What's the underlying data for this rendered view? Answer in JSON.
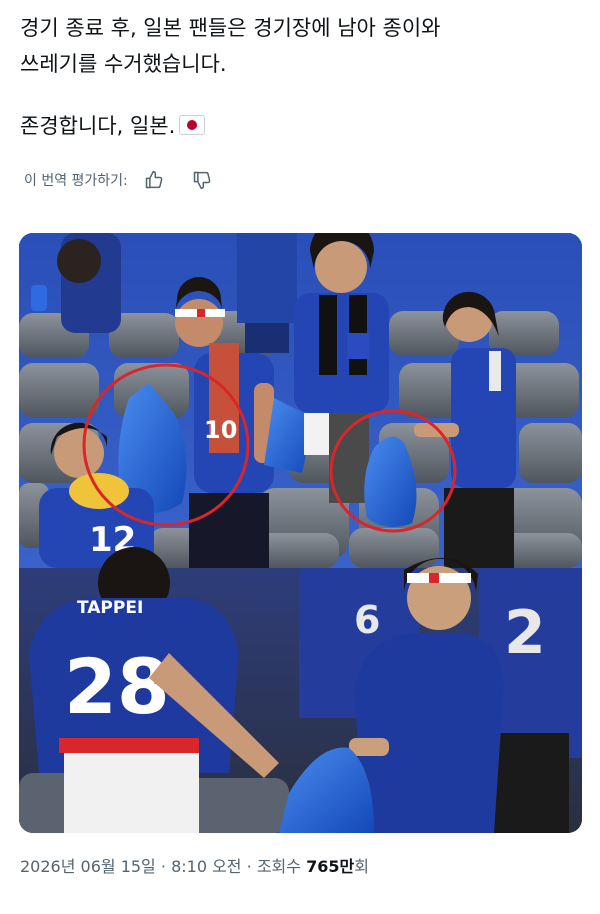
{
  "post": {
    "lines": [
      "경기 종료 후, 일본 팬들은 경기장에 남아 종이와",
      "쓰레기를 수거했습니다.",
      "존경합니다, 일본."
    ]
  },
  "translate": {
    "label": "이 번역 평가하기:"
  },
  "photo": {
    "jersey_numbers": [
      "10",
      "12",
      "28",
      "6",
      "2"
    ],
    "name_on_back": "TAPPEI"
  },
  "meta": {
    "date": "2026년 06월 15일",
    "separator1": "·",
    "time": "8:10 오전",
    "separator2": "·",
    "views_label": "조회수",
    "views_value": "765만",
    "views_suffix": "회"
  },
  "colors": {
    "text": "#0f1419",
    "muted": "#536471",
    "jersey_blue": "#1f3a9e",
    "circle_red": "#d8262b",
    "bag_blue": "#1e5fd8"
  }
}
